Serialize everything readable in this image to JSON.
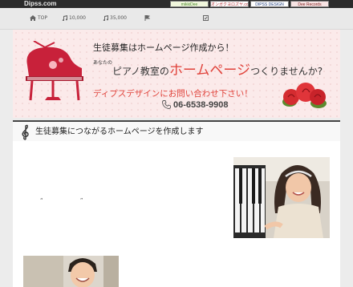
{
  "topbar": {
    "brand": "Dipss.com",
    "partners": [
      "mikkiDee",
      "オンガクヨロズヤ.com",
      "DIPSS DESIGN",
      "Dee Records"
    ]
  },
  "nav": {
    "items": [
      {
        "icon": "home-icon",
        "label": "TOP"
      },
      {
        "icon": "music-note-icon",
        "label": "10,000"
      },
      {
        "icon": "music-note-icon",
        "label": "35,000"
      },
      {
        "icon": "flag-icon",
        "label": ""
      },
      {
        "icon": "document-icon",
        "label": ""
      }
    ]
  },
  "hero": {
    "line1": "生徒募集はホームページ作成から！",
    "line2_small": "あなたの",
    "line2_a": "ピアノ教室の",
    "line2_b": "ホームページ",
    "line2_c": "つくりませんか?",
    "line3": "ディプスデザインにお問い合わせ下さい！",
    "phone": "06-6538-9908",
    "colors": {
      "accent": "#e0423a",
      "piano": "#c8213a"
    }
  },
  "section": {
    "title": "生徒募集につながるホームページを作成します",
    "icon": "treble-clef-icon"
  },
  "content": {
    "quotes": "“ ”"
  }
}
